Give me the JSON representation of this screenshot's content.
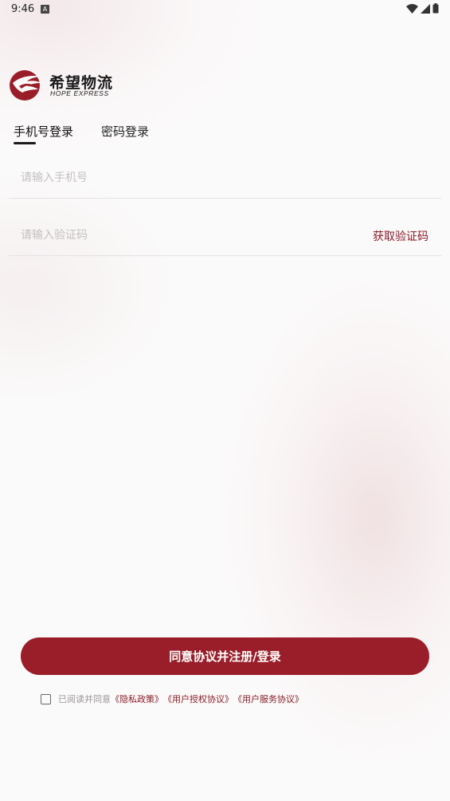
{
  "status_bar": {
    "time": "9:46",
    "notification_icon": "a-icon",
    "icons": [
      "wifi-icon",
      "signal-icon",
      "battery-icon"
    ]
  },
  "brand": {
    "name_cn": "希望物流",
    "name_en": "HOPE EXPRESS",
    "color": "#9a1e29"
  },
  "tabs": [
    {
      "label": "手机号登录",
      "active": true
    },
    {
      "label": "密码登录",
      "active": false
    }
  ],
  "form": {
    "phone": {
      "placeholder": "请输入手机号",
      "value": ""
    },
    "code": {
      "placeholder": "请输入验证码",
      "value": ""
    },
    "get_code_label": "获取验证码"
  },
  "submit_label": "同意协议并注册/登录",
  "agreement": {
    "checked": false,
    "prefix": "已阅读并同意",
    "links": [
      "《隐私政策》",
      "《用户授权协议》",
      "《用户服务协议》"
    ]
  },
  "colors": {
    "accent": "#9a1e29",
    "link": "#8a1b26",
    "placeholder": "#c4c0c0"
  }
}
